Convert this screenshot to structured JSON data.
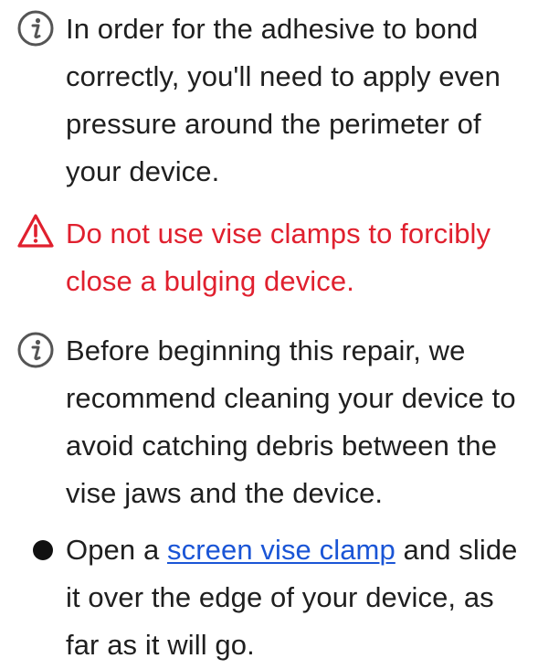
{
  "notes": [
    {
      "type": "info",
      "icon": "info-icon",
      "lines": [
        "In order for the adhesive to bond",
        "correctly, you'll need to apply even",
        "pressure around the perimeter of",
        "your device."
      ]
    },
    {
      "type": "caution",
      "icon": "caution-triangle-icon",
      "color": "#e0202e",
      "lines": [
        "Do not use vise clamps to forcibly",
        "close a bulging device."
      ]
    },
    {
      "type": "info",
      "icon": "info-icon",
      "lines": [
        "Before beginning this repair, we",
        "recommend cleaning your device to",
        "avoid catching debris between the",
        "vise jaws and the device."
      ]
    }
  ],
  "bullet": {
    "line1_before": "Open a ",
    "link_text": "screen vise clamp",
    "line1_after": " and slide",
    "line2": "it over the edge of your device, as",
    "line3": "far as it will go."
  },
  "colors": {
    "text": "#1f1f1f",
    "warning": "#e0202e",
    "link": "#1a55d6"
  }
}
